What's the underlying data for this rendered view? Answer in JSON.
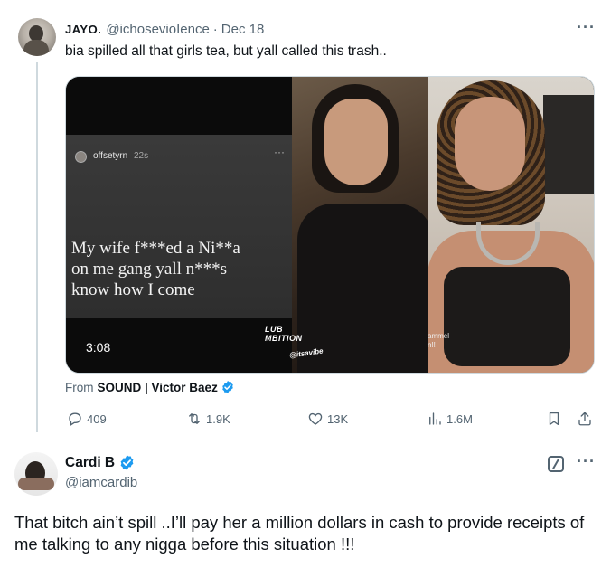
{
  "tweet1": {
    "display_name": "JAYO.",
    "handle": "@ichosevioIence",
    "separator": "·",
    "date": "Dec 18",
    "text": "bia spilled all that girls tea, but yall called this trash..",
    "more_icon": "···",
    "media": {
      "ig_username": "offsetyrn",
      "ig_time": "22s",
      "ig_more": "···",
      "ig_caption": "My wife f***ed a Ni**a\non me gang yall n***s\nknow how I come",
      "duration": "3:08",
      "watermark_main": "LUB\nMBITION",
      "watermark_handle": "@itsavibe",
      "watermark_right": "ammel\nn!!"
    },
    "source_prefix": "From",
    "source_name": "SOUND | Victor Baez",
    "actions": {
      "replies": "409",
      "reposts": "1.9K",
      "likes": "13K",
      "views": "1.6M"
    }
  },
  "tweet2": {
    "display_name": "Cardi B",
    "handle": "@iamcardib",
    "more_icon": "···",
    "text": "That bitch ain’t spill ..I’ll pay her a million dollars in cash to provide receipts of me talking to any nigga before this situation !!!"
  },
  "colors": {
    "verified_blue": "#1d9bf0",
    "secondary_text": "#536471",
    "primary_text": "#0f1419"
  }
}
